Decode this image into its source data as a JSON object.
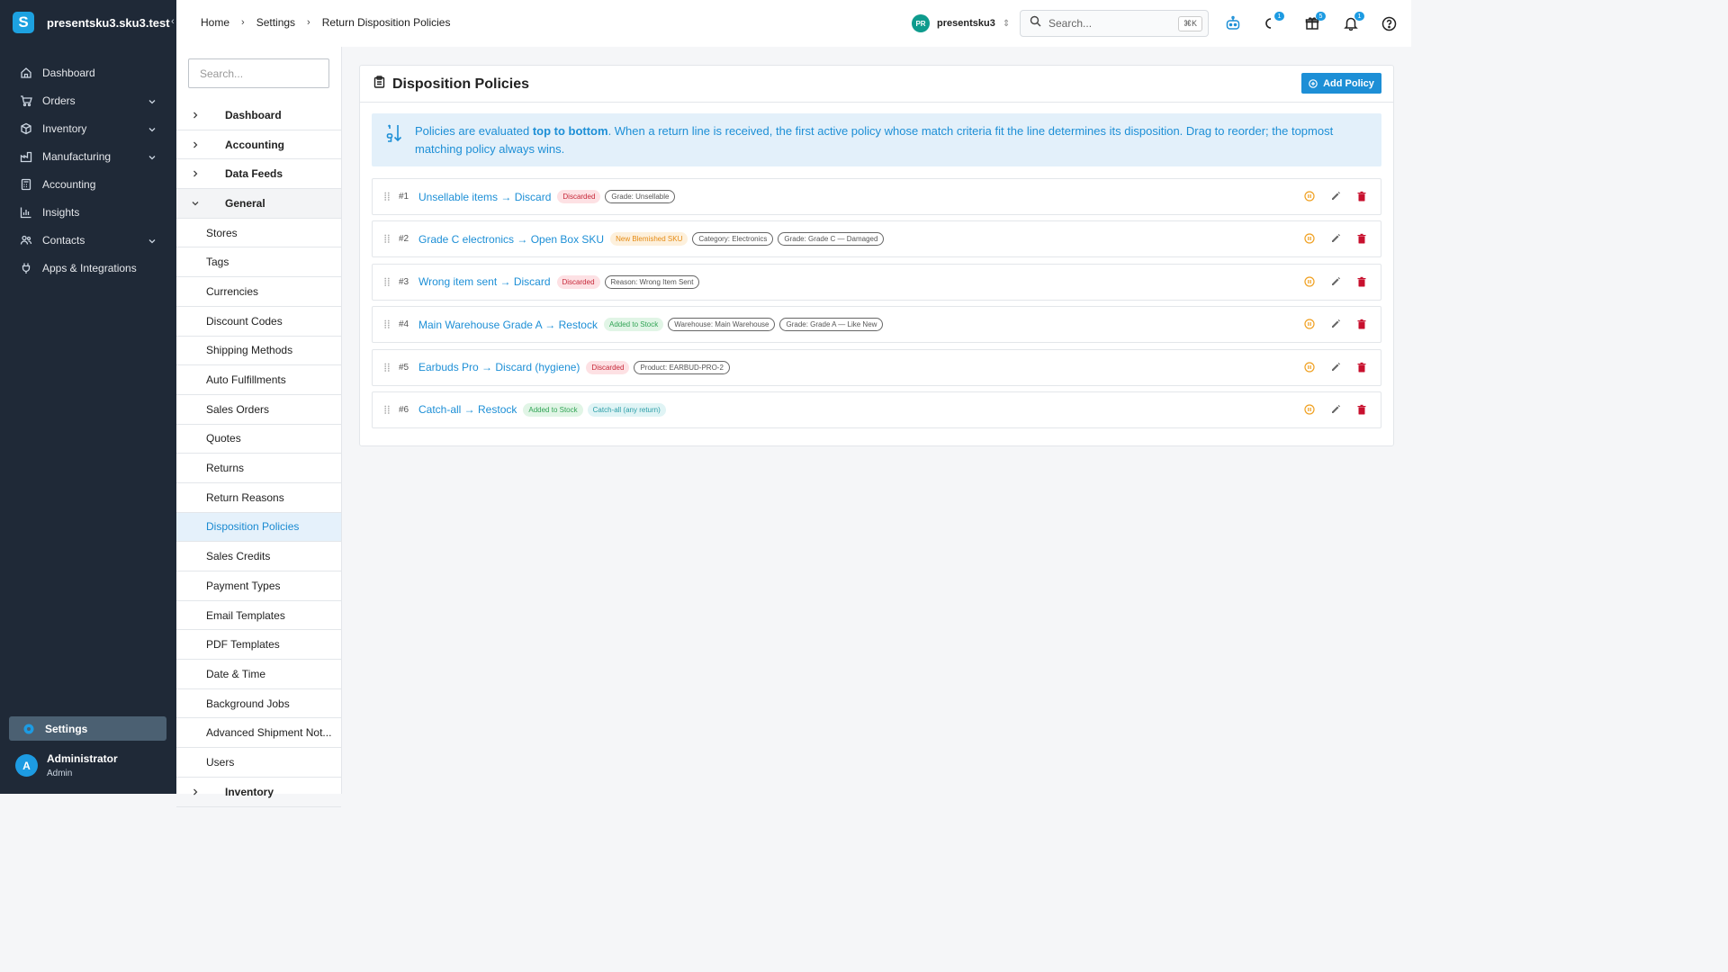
{
  "app": {
    "name": "presentsku3.sku3.test",
    "logo": "S"
  },
  "sidebar": {
    "items": [
      {
        "label": "Dashboard",
        "icon": "home-icon"
      },
      {
        "label": "Orders",
        "icon": "cart-icon"
      },
      {
        "label": "Inventory",
        "icon": "box-icon"
      },
      {
        "label": "Manufacturing",
        "icon": "factory-icon"
      },
      {
        "label": "Accounting",
        "icon": "calculator-icon"
      },
      {
        "label": "Insights",
        "icon": "chart-icon"
      },
      {
        "label": "Contacts",
        "icon": "people-icon"
      },
      {
        "label": "Apps & Integrations",
        "icon": "plug-icon"
      }
    ],
    "settings": "Settings",
    "user": {
      "initial": "A",
      "name": "Administrator",
      "role": "Admin"
    }
  },
  "topbar": {
    "breadcrumb": [
      "Home",
      "Settings",
      "Return Disposition Policies"
    ],
    "company": {
      "initials": "PR",
      "name": "presentsku3"
    },
    "search": {
      "placeholder": "Search...",
      "shortcut": "⌘K"
    },
    "badges": {
      "loader": "1",
      "gift": "5",
      "bell": "1"
    }
  },
  "submenu": {
    "search_placeholder": "Search...",
    "items": [
      {
        "label": "Dashboard",
        "type": "group"
      },
      {
        "label": "Accounting",
        "type": "group"
      },
      {
        "label": "Data Feeds",
        "type": "group"
      },
      {
        "label": "General",
        "type": "group-open"
      },
      {
        "label": "Stores",
        "type": "sub"
      },
      {
        "label": "Tags",
        "type": "sub"
      },
      {
        "label": "Currencies",
        "type": "sub"
      },
      {
        "label": "Discount Codes",
        "type": "sub"
      },
      {
        "label": "Shipping Methods",
        "type": "sub"
      },
      {
        "label": "Auto Fulfillments",
        "type": "sub"
      },
      {
        "label": "Sales Orders",
        "type": "sub"
      },
      {
        "label": "Quotes",
        "type": "sub"
      },
      {
        "label": "Returns",
        "type": "sub"
      },
      {
        "label": "Return Reasons",
        "type": "sub"
      },
      {
        "label": "Disposition Policies",
        "type": "sub-active"
      },
      {
        "label": "Sales Credits",
        "type": "sub"
      },
      {
        "label": "Payment Types",
        "type": "sub"
      },
      {
        "label": "Email Templates",
        "type": "sub"
      },
      {
        "label": "PDF Templates",
        "type": "sub"
      },
      {
        "label": "Date & Time",
        "type": "sub"
      },
      {
        "label": "Background Jobs",
        "type": "sub"
      },
      {
        "label": "Advanced Shipment Not...",
        "type": "sub"
      },
      {
        "label": "Users",
        "type": "sub"
      },
      {
        "label": "Inventory",
        "type": "group"
      }
    ]
  },
  "panel": {
    "title": "Disposition Policies",
    "add_button": "Add Policy",
    "info_pre": "Policies are evaluated ",
    "info_bold": "top to bottom",
    "info_post": ". When a return line is received, the first active policy whose match criteria fit the line determines its disposition. Drag to reorder; the topmost matching policy always wins.",
    "policies": [
      {
        "num": "#1",
        "name": "Unsellable items → Discard",
        "tags": [
          {
            "text": "Discarded",
            "style": "red"
          },
          {
            "text": "Grade: Unsellable",
            "style": "outline"
          }
        ]
      },
      {
        "num": "#2",
        "name": "Grade C electronics → Open Box SKU",
        "tags": [
          {
            "text": "New Blemished SKU",
            "style": "orange"
          },
          {
            "text": "Category: Electronics",
            "style": "outline"
          },
          {
            "text": "Grade: Grade C — Damaged",
            "style": "outline"
          }
        ]
      },
      {
        "num": "#3",
        "name": "Wrong item sent → Discard",
        "tags": [
          {
            "text": "Discarded",
            "style": "red"
          },
          {
            "text": "Reason: Wrong Item Sent",
            "style": "outline"
          }
        ]
      },
      {
        "num": "#4",
        "name": "Main Warehouse Grade A → Restock",
        "tags": [
          {
            "text": "Added to Stock",
            "style": "green"
          },
          {
            "text": "Warehouse: Main Warehouse",
            "style": "outline"
          },
          {
            "text": "Grade: Grade A — Like New",
            "style": "outline"
          }
        ]
      },
      {
        "num": "#5",
        "name": "Earbuds Pro → Discard (hygiene)",
        "tags": [
          {
            "text": "Discarded",
            "style": "red"
          },
          {
            "text": "Product: EARBUD-PRO-2",
            "style": "outline"
          }
        ]
      },
      {
        "num": "#6",
        "name": "Catch-all → Restock",
        "tags": [
          {
            "text": "Added to Stock",
            "style": "green"
          },
          {
            "text": "Catch-all (any return)",
            "style": "teal"
          }
        ]
      }
    ]
  },
  "colors": {
    "accent": "#1d8fd6",
    "sidebar_bg": "#1f2937",
    "danger": "#c8102e",
    "pause": "#f0a020"
  }
}
